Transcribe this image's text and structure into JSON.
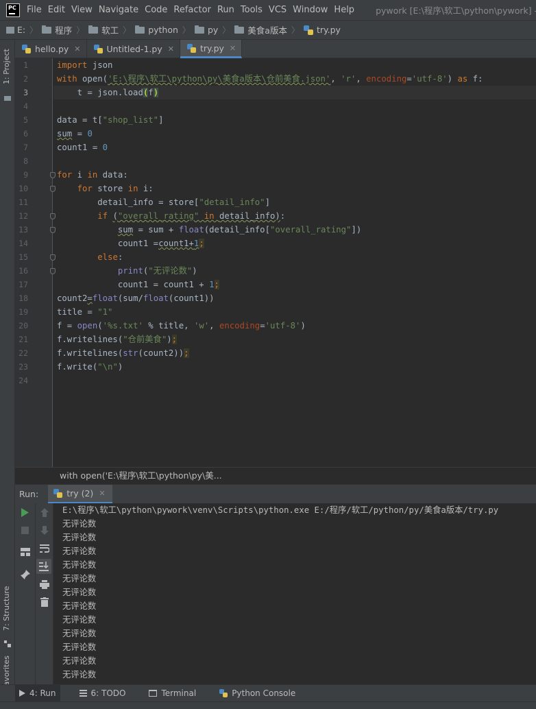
{
  "menubar": {
    "logo_text": "PC",
    "items": [
      "File",
      "Edit",
      "View",
      "Navigate",
      "Code",
      "Refactor",
      "Run",
      "Tools",
      "VCS",
      "Window",
      "Help"
    ],
    "window_title": "pywork [E:\\程序\\软工\\python\\pywork] - E"
  },
  "breadcrumb": [
    "E:",
    "程序",
    "软工",
    "python",
    "py",
    "美食a版本",
    "try.py"
  ],
  "left_stripe": {
    "project": "1: Project",
    "structure": "7: Structure",
    "favorites": "2: Favorites"
  },
  "editor_tabs": [
    {
      "label": "hello.py",
      "active": false
    },
    {
      "label": "Untitled-1.py",
      "active": false
    },
    {
      "label": "try.py",
      "active": true
    }
  ],
  "editor": {
    "current_line": 3,
    "line_numbers": [
      "1",
      "2",
      "3",
      "4",
      "5",
      "6",
      "7",
      "8",
      "9",
      "10",
      "11",
      "12",
      "13",
      "14",
      "15",
      "16",
      "17",
      "18",
      "19",
      "20",
      "21",
      "22",
      "23",
      "24"
    ],
    "lines": [
      {
        "indent": "",
        "parts": [
          {
            "t": "import ",
            "c": "k"
          },
          {
            "t": "json",
            "c": "v"
          }
        ]
      },
      {
        "indent": "",
        "parts": [
          {
            "t": "with ",
            "c": "k"
          },
          {
            "t": "open(",
            "c": "v"
          },
          {
            "t": "'E:\\程序\\软工\\python\\py\\美食a版本\\仓前美食.json'",
            "c": "s wv"
          },
          {
            "t": ", ",
            "c": "v"
          },
          {
            "t": "'r'",
            "c": "s"
          },
          {
            "t": ", ",
            "c": "v"
          },
          {
            "t": "encoding",
            "c": "kw"
          },
          {
            "t": "=",
            "c": "v"
          },
          {
            "t": "'utf-8'",
            "c": "s"
          },
          {
            "t": ") ",
            "c": "v"
          },
          {
            "t": "as ",
            "c": "k"
          },
          {
            "t": "f:",
            "c": "v"
          }
        ]
      },
      {
        "indent": "    ",
        "parts": [
          {
            "t": "t = json.load",
            "c": "v"
          },
          {
            "t": "(",
            "c": "brace"
          },
          {
            "t": "f",
            "c": "v"
          },
          {
            "t": ")",
            "c": "brace"
          }
        ]
      },
      {
        "indent": "",
        "parts": []
      },
      {
        "indent": "",
        "parts": [
          {
            "t": "data = t[",
            "c": "v"
          },
          {
            "t": "\"shop_list\"",
            "c": "s"
          },
          {
            "t": "]",
            "c": "v"
          }
        ]
      },
      {
        "indent": "",
        "parts": [
          {
            "t": "sum",
            "c": "v wv"
          },
          {
            "t": " = ",
            "c": "v"
          },
          {
            "t": "0",
            "c": "n"
          }
        ]
      },
      {
        "indent": "",
        "parts": [
          {
            "t": "count1 = ",
            "c": "v"
          },
          {
            "t": "0",
            "c": "n"
          }
        ]
      },
      {
        "indent": "",
        "parts": []
      },
      {
        "indent": "",
        "parts": [
          {
            "t": "for ",
            "c": "k"
          },
          {
            "t": "i ",
            "c": "v"
          },
          {
            "t": "in ",
            "c": "k"
          },
          {
            "t": "data:",
            "c": "v"
          }
        ]
      },
      {
        "indent": "    ",
        "parts": [
          {
            "t": "for ",
            "c": "k"
          },
          {
            "t": "store ",
            "c": "v"
          },
          {
            "t": "in ",
            "c": "k"
          },
          {
            "t": "i:",
            "c": "v"
          }
        ]
      },
      {
        "indent": "        ",
        "parts": [
          {
            "t": "detail_info = store[",
            "c": "v"
          },
          {
            "t": "\"detail_info\"",
            "c": "s"
          },
          {
            "t": "]",
            "c": "v"
          }
        ]
      },
      {
        "indent": "        ",
        "parts": [
          {
            "t": "if ",
            "c": "k"
          },
          {
            "t": "(",
            "c": "v wv"
          },
          {
            "t": "\"overall_rating\"",
            "c": "s wv"
          },
          {
            "t": " in ",
            "c": "k wv"
          },
          {
            "t": "detail_info)",
            "c": "v wv"
          },
          {
            "t": ":",
            "c": "v"
          }
        ]
      },
      {
        "indent": "            ",
        "parts": [
          {
            "t": "sum",
            "c": "v wv"
          },
          {
            "t": " = sum + ",
            "c": "v"
          },
          {
            "t": "float",
            "c": "b"
          },
          {
            "t": "(detail_info[",
            "c": "v"
          },
          {
            "t": "\"overall_rating\"",
            "c": "s"
          },
          {
            "t": "])",
            "c": "v"
          }
        ]
      },
      {
        "indent": "            ",
        "parts": [
          {
            "t": "count1 =",
            "c": "v"
          },
          {
            "t": "count1+",
            "c": "v wv"
          },
          {
            "t": "1",
            "c": "n wv"
          },
          {
            "t": ";",
            "c": "k semi"
          }
        ]
      },
      {
        "indent": "        ",
        "parts": [
          {
            "t": "else",
            "c": "k"
          },
          {
            "t": ":",
            "c": "v"
          }
        ]
      },
      {
        "indent": "            ",
        "parts": [
          {
            "t": "print",
            "c": "b"
          },
          {
            "t": "(",
            "c": "v"
          },
          {
            "t": "\"无评论数\"",
            "c": "s"
          },
          {
            "t": ")",
            "c": "v"
          }
        ]
      },
      {
        "indent": "            ",
        "parts": [
          {
            "t": "count1 = count1 + ",
            "c": "v"
          },
          {
            "t": "1",
            "c": "n"
          },
          {
            "t": ";",
            "c": "k semi"
          }
        ]
      },
      {
        "indent": "",
        "parts": [
          {
            "t": "count2",
            "c": "v"
          },
          {
            "t": "=",
            "c": "v wv"
          },
          {
            "t": "float",
            "c": "b"
          },
          {
            "t": "(sum/",
            "c": "v"
          },
          {
            "t": "float",
            "c": "b"
          },
          {
            "t": "(count1))",
            "c": "v"
          }
        ]
      },
      {
        "indent": "",
        "parts": [
          {
            "t": "title = ",
            "c": "v"
          },
          {
            "t": "\"1\"",
            "c": "s"
          }
        ]
      },
      {
        "indent": "",
        "parts": [
          {
            "t": "f = ",
            "c": "v"
          },
          {
            "t": "open",
            "c": "b"
          },
          {
            "t": "(",
            "c": "v"
          },
          {
            "t": "'%s.txt'",
            "c": "s"
          },
          {
            "t": " % title, ",
            "c": "v"
          },
          {
            "t": "'w'",
            "c": "s"
          },
          {
            "t": ", ",
            "c": "v"
          },
          {
            "t": "encoding",
            "c": "kw"
          },
          {
            "t": "=",
            "c": "v"
          },
          {
            "t": "'utf-8'",
            "c": "s"
          },
          {
            "t": ")",
            "c": "v"
          }
        ]
      },
      {
        "indent": "",
        "parts": [
          {
            "t": "f.writelines(",
            "c": "v"
          },
          {
            "t": "\"仓前美食\"",
            "c": "s"
          },
          {
            "t": ")",
            "c": "v"
          },
          {
            "t": ";",
            "c": "k semi"
          }
        ]
      },
      {
        "indent": "",
        "parts": [
          {
            "t": "f.writelines(",
            "c": "v"
          },
          {
            "t": "str",
            "c": "b"
          },
          {
            "t": "(count2))",
            "c": "v"
          },
          {
            "t": ";",
            "c": "k semi"
          }
        ]
      },
      {
        "indent": "",
        "parts": [
          {
            "t": "f.write(",
            "c": "v"
          },
          {
            "t": "\"\\n\"",
            "c": "s"
          },
          {
            "t": ")",
            "c": "v"
          }
        ]
      },
      {
        "indent": "",
        "parts": []
      }
    ],
    "fold_lines": [
      9,
      10,
      12,
      13,
      15,
      16
    ]
  },
  "hint": "with open('E:\\程序\\软工\\python\\py\\美...",
  "run": {
    "label": "Run:",
    "tab_label": "try (2)",
    "console": [
      "E:\\程序\\软工\\python\\pywork\\venv\\Scripts\\python.exe E:/程序/软工/python/py/美食a版本/try.py",
      "无评论数",
      "无评论数",
      "无评论数",
      "无评论数",
      "无评论数",
      "无评论数",
      "无评论数",
      "无评论数",
      "无评论数",
      "无评论数",
      "无评论数",
      "无评论数"
    ]
  },
  "bottom_tabs": [
    {
      "label": "4: Run",
      "icon": "play-icon",
      "active": true
    },
    {
      "label": "6: TODO",
      "icon": "todo-icon",
      "active": false
    },
    {
      "label": "Terminal",
      "icon": "terminal-icon",
      "active": false
    },
    {
      "label": "Python Console",
      "icon": "python-icon",
      "active": false
    }
  ],
  "colors": {
    "keyword": "#cc7832",
    "string": "#6a8759",
    "number": "#6897bb",
    "builtin": "#8888c6",
    "accent": "#4a88c7",
    "run_green": "#499c54"
  }
}
